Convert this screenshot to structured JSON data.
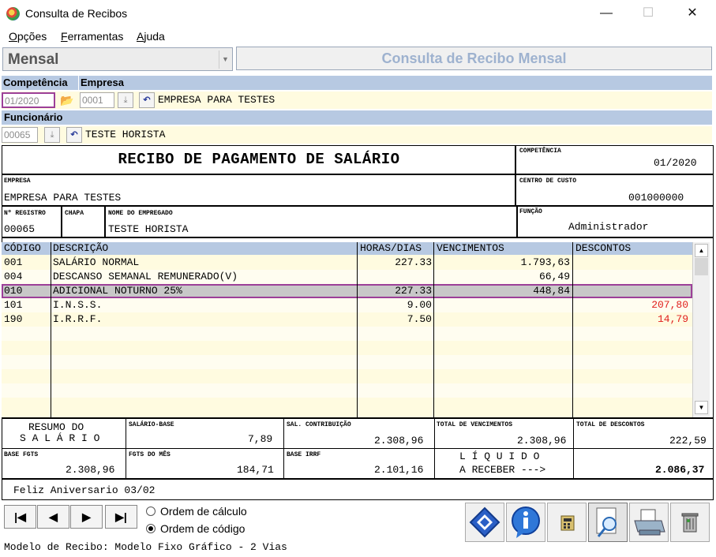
{
  "window": {
    "title": "Consulta de Recibos",
    "minimize": "—",
    "maximize": "☐",
    "close": "✕"
  },
  "menu": {
    "items": [
      {
        "label": "Opções",
        "underline": "O",
        "rest": "pções"
      },
      {
        "label": "Ferramentas",
        "underline": "F",
        "rest": "erramentas"
      },
      {
        "label": "Ajuda",
        "underline": "A",
        "rest": "juda"
      }
    ]
  },
  "toolbar": {
    "mode_select": "Mensal",
    "screen_title": "Consulta de Recibo Mensal"
  },
  "filters": {
    "competencia_label": "Competência",
    "empresa_label": "Empresa",
    "competencia_value": "01/2020",
    "empresa_code": "0001",
    "empresa_name": "EMPRESA PARA TESTES",
    "funcionario_label": "Funcionário",
    "funcionario_code": "00065",
    "funcionario_name": "TESTE HORISTA"
  },
  "receipt": {
    "title": "RECIBO DE PAGAMENTO DE SALÁRIO",
    "competencia_caption": "COMPETÊNCIA",
    "competencia": "01/2020",
    "empresa_caption": "EMPRESA",
    "empresa": "EMPRESA PARA TESTES",
    "centro_caption": "CENTRO DE CUSTO",
    "centro": "001000000",
    "registro_caption": "Nº REGISTRO",
    "registro": "00065",
    "chapa_caption": "CHAPA",
    "chapa": "",
    "nome_caption": "NOME DO EMPREGADO",
    "nome": "TESTE HORISTA",
    "funcao_caption": "FUNÇÃO",
    "funcao": "Administrador"
  },
  "grid": {
    "headers": {
      "codigo": "CÓDIGO",
      "descricao": "DESCRIÇÃO",
      "horas": "HORAS/DIAS",
      "vencimentos": "VENCIMENTOS",
      "descontos": "DESCONTOS"
    },
    "rows": [
      {
        "codigo": "001",
        "descricao": "SALÁRIO NORMAL",
        "horas": "227.33",
        "vencimentos": "1.793,63",
        "descontos": ""
      },
      {
        "codigo": "004",
        "descricao": "DESCANSO SEMANAL REMUNERADO(V)",
        "horas": "",
        "vencimentos": "66,49",
        "descontos": ""
      },
      {
        "codigo": "010",
        "descricao": "ADICIONAL NOTURNO  25%",
        "horas": "227.33",
        "vencimentos": "448,84",
        "descontos": ""
      },
      {
        "codigo": "101",
        "descricao": "I.N.S.S.",
        "horas": "9.00",
        "vencimentos": "",
        "descontos": "207,80"
      },
      {
        "codigo": "190",
        "descricao": "I.R.R.F.",
        "horas": "7.50",
        "vencimentos": "",
        "descontos": "14,79"
      }
    ],
    "selected_row": 2
  },
  "summary": {
    "resumo_line1": "RESUMO DO",
    "resumo_line2": "S A L Á R I O",
    "salario_base_caption": "SALÁRIO-BASE",
    "salario_base": "7,89",
    "sal_contrib_caption": "SAL. CONTRIBUIÇÃO",
    "sal_contrib": "2.308,96",
    "total_venc_caption": "TOTAL DE VENCIMENTOS",
    "total_venc": "2.308,96",
    "total_desc_caption": "TOTAL DE DESCONTOS",
    "total_desc": "222,59",
    "base_fgts_caption": "BASE FGTS",
    "base_fgts": "2.308,96",
    "fgts_mes_caption": "FGTS DO MÊS",
    "fgts_mes": "184,71",
    "base_irrf_caption": "BASE IRRF",
    "base_irrf": "2.101,16",
    "liquido_line1": "L Í Q U I D O",
    "liquido_line2": "A RECEBER --->",
    "liquido": "2.086,37",
    "message": "Feliz Aniversario 03/02"
  },
  "footer": {
    "first": "|◀",
    "prev": "◀",
    "next": "▶",
    "last": "▶|",
    "order_calc": "Ordem de cálculo",
    "order_code": "Ordem de código",
    "model": "Modelo de Recibo: Modelo Fixo Gráfico - 2 Vias"
  },
  "colors": {
    "header_blue": "#b7c9e2",
    "field_yellow": "#fffbe0",
    "highlight_purple": "#9c3f98",
    "discount_red": "#e0201e",
    "selected_row": "#c8c8c8"
  }
}
